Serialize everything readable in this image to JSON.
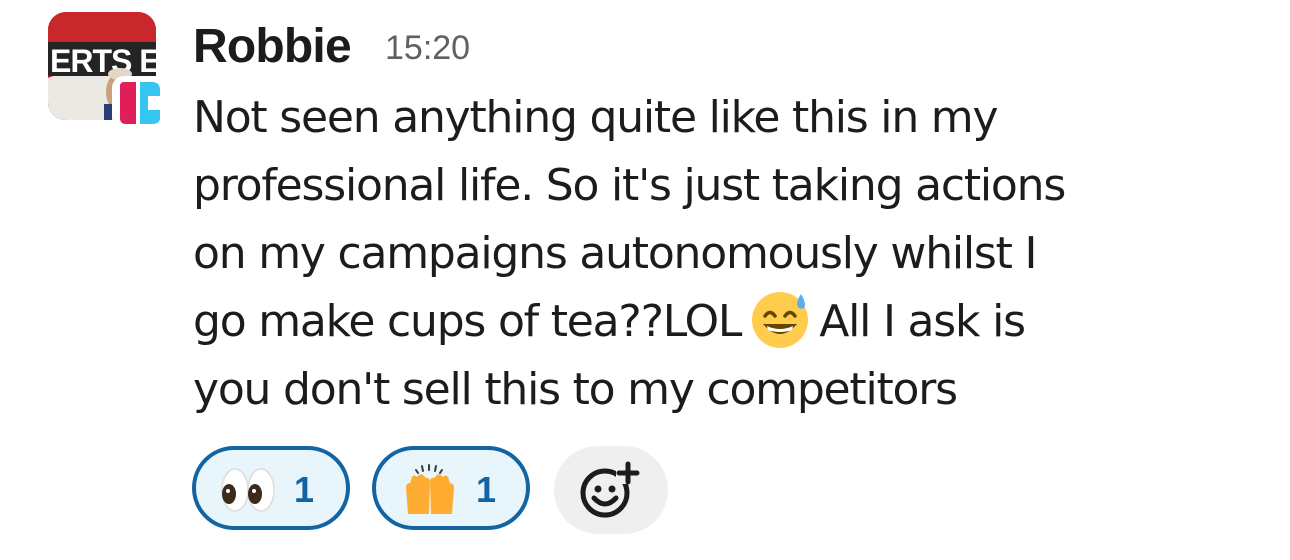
{
  "message": {
    "author": "Robbie",
    "timestamp": "15:20",
    "avatar_text": "ERTS E",
    "lines": [
      "Not seen anything quite like this in my",
      "professional life. So it's just taking actions",
      "on my campaigns autonomously whilst I",
      "go make cups of tea??LOL",
      "All I ask is",
      "you don't sell this to my competitors"
    ],
    "inline_emoji": "grinning-face-with-sweat-icon"
  },
  "reactions": [
    {
      "emoji": "eyes-icon",
      "count": "1",
      "active": true
    },
    {
      "emoji": "raising-hands-icon",
      "count": "1",
      "active": true
    }
  ],
  "add_reaction": {
    "icon": "add-reaction-icon"
  },
  "colors": {
    "text": "#1d1c1d",
    "timestamp": "#616061",
    "reaction_border": "#1264a3",
    "reaction_bg": "#e8f5fa",
    "add_reaction_bg": "#efefef",
    "app_badge_pink": "#e01e5a",
    "app_badge_blue": "#36c5f0"
  }
}
